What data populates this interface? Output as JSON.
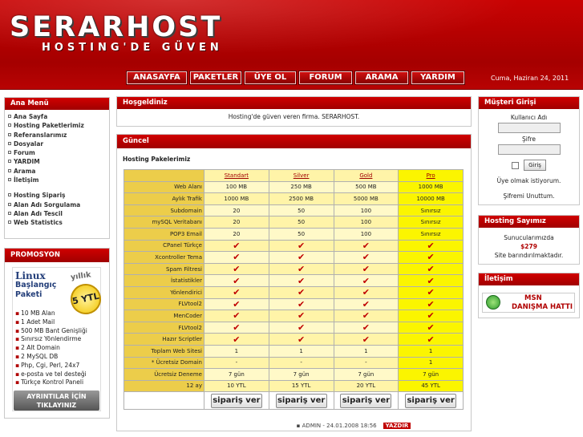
{
  "header": {
    "logo_main": "SERARHOST",
    "logo_sub": "HOSTING'DE GÜVEN",
    "date": "Cuma, Haziran 24, 2011",
    "nav": [
      "ANASAYFA",
      "PAKETLER",
      "ÜYE OL",
      "FORUM",
      "ARAMA",
      "YARDIM"
    ]
  },
  "left_menu": {
    "title": "Ana Menü",
    "items_a": [
      "Ana Sayfa",
      "Hosting Paketlerimiz",
      "Referanslarımız",
      "Dosyalar",
      "Forum",
      "YARDIM",
      "Arama",
      "İletişim"
    ],
    "items_b": [
      "Hosting Sipariş",
      "Alan Adı Sorgulama",
      "Alan Adı Tescil",
      "Web Statistics"
    ]
  },
  "promo": {
    "title": "PROMOSYON",
    "linux": "Linux",
    "baslangic": "Başlangıç",
    "paketi": "Paketi",
    "yillik": "yıllık",
    "price": "5 YTL",
    "features": [
      "10 MB Alan",
      "1 Adet Mail",
      "500 MB Bant Genişliği",
      "Sınırsız Yönlendirme",
      "2 Alt Domain",
      "2 MySQL DB",
      "Php, Cgi, Perl, 24x7",
      "e-posta ve tel desteği",
      "Türkçe Kontrol Paneli"
    ],
    "button_line1": "AYRINTILAR İÇİN",
    "button_line2": "TIKLAYINIZ"
  },
  "welcome": {
    "title": "Hoşgeldiniz",
    "text": "Hosting'de güven veren firma. SERARHOST."
  },
  "current": {
    "title": "Güncel",
    "section": "Hosting Pakelerimiz",
    "plans": [
      "Standart",
      "Silver",
      "Gold",
      "Pro"
    ],
    "rows": [
      {
        "label": "Web Alanı",
        "v": [
          "100 MB",
          "250 MB",
          "500 MB",
          "1000 MB"
        ]
      },
      {
        "label": "Aylık Trafik",
        "v": [
          "1000 MB",
          "2500 MB",
          "5000 MB",
          "10000 MB"
        ]
      },
      {
        "label": "Subdomain",
        "v": [
          "20",
          "50",
          "100",
          "Sınırsız"
        ]
      },
      {
        "label": "mySQL Veritabanı",
        "v": [
          "20",
          "50",
          "100",
          "Sınırsız"
        ]
      },
      {
        "label": "POP3 Email",
        "v": [
          "20",
          "50",
          "100",
          "Sınırsız"
        ]
      },
      {
        "label": "CPanel Türkçe",
        "v": [
          "✔",
          "✔",
          "✔",
          "✔"
        ]
      },
      {
        "label": "Xcontroller Tema",
        "v": [
          "✔",
          "✔",
          "✔",
          "✔"
        ]
      },
      {
        "label": "Spam Filtresi",
        "v": [
          "✔",
          "✔",
          "✔",
          "✔"
        ]
      },
      {
        "label": "İstatistikler",
        "v": [
          "✔",
          "✔",
          "✔",
          "✔"
        ]
      },
      {
        "label": "Yönlendirici",
        "v": [
          "✔",
          "✔",
          "✔",
          "✔"
        ]
      },
      {
        "label": "FLVtool2",
        "v": [
          "✔",
          "✔",
          "✔",
          "✔"
        ]
      },
      {
        "label": "MenCoder",
        "v": [
          "✔",
          "✔",
          "✔",
          "✔"
        ]
      },
      {
        "label": "FLVtool2",
        "v": [
          "✔",
          "✔",
          "✔",
          "✔"
        ]
      },
      {
        "label": "Hazır Scriptler",
        "v": [
          "✔",
          "✔",
          "✔",
          "✔"
        ]
      },
      {
        "label": "Toplam Web Sitesi",
        "v": [
          "1",
          "1",
          "1",
          "1"
        ]
      },
      {
        "label": "* Ücretsiz Domain",
        "v": [
          "-",
          "-",
          "-",
          "1"
        ]
      },
      {
        "label": "Ücretsiz Deneme",
        "v": [
          "7 gün",
          "7 gün",
          "7 gün",
          "7 gün"
        ]
      },
      {
        "label": "12 ay",
        "v": [
          "10 YTL",
          "15 YTL",
          "20 YTL",
          "45 YTL"
        ]
      }
    ],
    "order_label": "sipariş ver",
    "footer": "ADMIN - 24.01.2008 18:56",
    "print": "YAZDIR"
  },
  "login": {
    "title": "Müşteri Girişi",
    "username_label": "Kullanıcı Adı",
    "password_label": "Şifre",
    "submit": "Giriş",
    "register": "Üye olmak istiyorum.",
    "forgot": "Şifremi Unuttum."
  },
  "counter": {
    "title": "Hosting Sayımız",
    "line1": "Sunucularımızda",
    "count": "$279",
    "line2": "Site barındırılmaktadır."
  },
  "contact": {
    "title": "İletişim",
    "msn_line1": "MSN",
    "msn_line2": "DANIŞMA HATTI"
  },
  "colors": {
    "brand_red": "#b00000",
    "table_gold": "#eccd4a",
    "pro_yellow": "#fbf500"
  }
}
